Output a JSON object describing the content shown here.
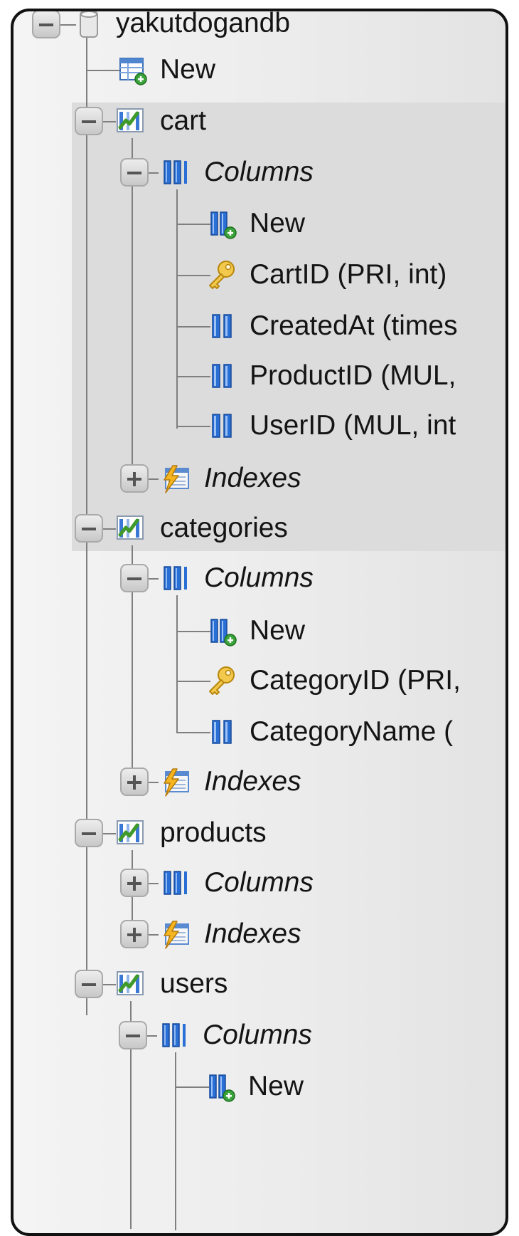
{
  "database": {
    "name": "yakutdogandb",
    "new_label": "New"
  },
  "tables": [
    {
      "name": "cart",
      "columns_label": "Columns",
      "indexes_label": "Indexes",
      "columns": [
        {
          "label": "New",
          "icon": "new-column-icon"
        },
        {
          "label": "CartID (PRI, int)",
          "icon": "primary-key-icon"
        },
        {
          "label": "CreatedAt (times",
          "icon": "column-icon"
        },
        {
          "label": "ProductID (MUL,",
          "icon": "column-icon"
        },
        {
          "label": "UserID (MUL, int",
          "icon": "column-icon"
        }
      ]
    },
    {
      "name": "categories",
      "columns_label": "Columns",
      "indexes_label": "Indexes",
      "columns": [
        {
          "label": "New",
          "icon": "new-column-icon"
        },
        {
          "label": "CategoryID (PRI,",
          "icon": "primary-key-icon"
        },
        {
          "label": "CategoryName (",
          "icon": "column-icon"
        }
      ]
    },
    {
      "name": "products",
      "columns_label": "Columns",
      "indexes_label": "Indexes"
    },
    {
      "name": "users",
      "columns_label": "Columns",
      "columns": [
        {
          "label": "New",
          "icon": "new-column-icon"
        }
      ]
    }
  ],
  "colors": {
    "highlight_row": "#dcdcdc",
    "tree_line": "#7f7f7f",
    "column_icon_blue": "#2a6fd6",
    "key_gold": "#e8b830"
  }
}
